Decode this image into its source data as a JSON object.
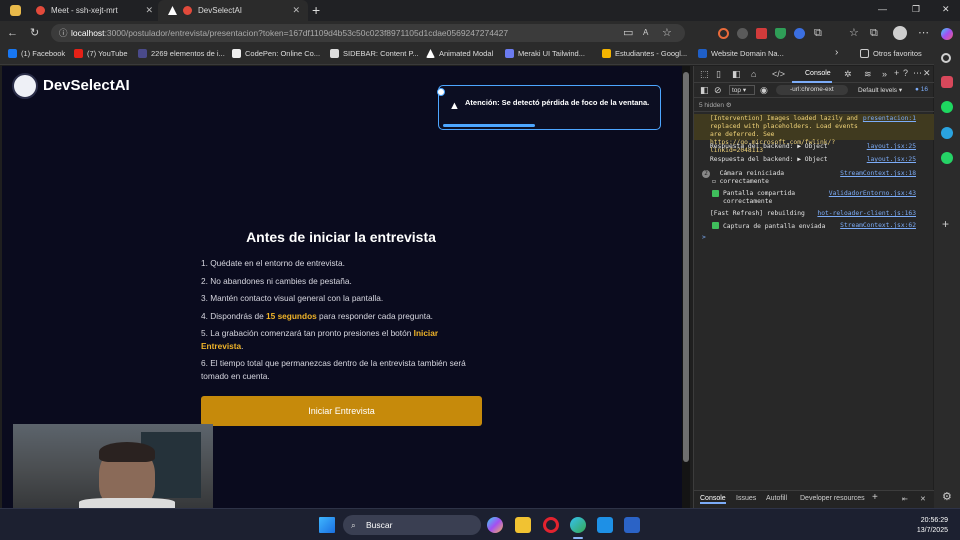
{
  "browser": {
    "tabs": [
      {
        "title": "Meet - ssh-xejt-mrt",
        "active": false
      },
      {
        "title": "DevSelectAI",
        "active": true
      }
    ],
    "new_tab": "+",
    "url_host": "localhost",
    "url_rest": ":3000/postulador/entrevista/presentacion?token=167df1109d4b53c50c023f8971105d1cdae0569247274427",
    "bookmarks": [
      "(1) Facebook",
      "(7) YouTube",
      "2269 elementos de i...",
      "CodePen: Online Co...",
      "SIDEBAR: Content P...",
      "Animated Modal",
      "Meraki UI Tailwind...",
      "Estudiantes - Googl...",
      "Website Domain Na...",
      "Otros favoritos"
    ]
  },
  "page": {
    "brand": "DevSelectAI",
    "alert": "Atención: Se detectó pérdida de foco de la ventana.",
    "title": "Antes de iniciar la entrevista",
    "instructions": {
      "i1": "1. Quédate en el entorno de entrevista.",
      "i2": "2. No abandones ni cambies de pestaña.",
      "i3": "3. Mantén contacto visual general con la pantalla.",
      "i4_pre": "4. Dispondrás de ",
      "i4_hl": "15 segundos",
      "i4_post": " para responder cada pregunta.",
      "i5_pre": "5. La grabación comenzará tan pronto presiones el botón ",
      "i5_hl": "Iniciar Entrevista",
      "i5_post": ".",
      "i6": "6. El tiempo total que permanezcas dentro de la entrevista también será tomado en cuenta."
    },
    "start_button": "Iniciar Entrevista"
  },
  "devtools": {
    "active_tab": "Console",
    "context": "top",
    "filter": "-url:chrome-ext",
    "levels": "Default levels",
    "issues_count": "16",
    "hidden": "5 hidden",
    "logs": [
      {
        "text": "[Intervention] Images loaded lazily and replaced with placeholders. Load events are deferred. See https://go.microsoft.com/fwlink/?linkid=2048113",
        "src": "presentacion:1"
      },
      {
        "text": "Respuesta del backend:  ▶ Object",
        "src": "layout.jsx:25"
      },
      {
        "text": "Respuesta del backend:  ▶ Object",
        "src": "layout.jsx:25"
      },
      {
        "text": "Cámara reiniciada correctamente",
        "src": "StreamContext.jsx:18",
        "count": "2"
      },
      {
        "text": "Pantalla compartida correctamente",
        "src": "ValidadorEntorno.jsx:43"
      },
      {
        "text": "[Fast Refresh] rebuilding",
        "src": "hot-reloader-client.js:163"
      },
      {
        "text": "Captura de pantalla enviada",
        "src": "StreamContext.jsx:62"
      }
    ],
    "prompt": ">",
    "bottom_tabs": [
      "Console",
      "Issues",
      "Autofill",
      "Developer resources"
    ]
  },
  "taskbar": {
    "search": "Buscar",
    "time": "20:56:29",
    "date": "13/7/2025"
  },
  "colors": {
    "page_bg": "#0a0b1e",
    "accent_button": "#c68a0b",
    "highlight": "#f0b429",
    "alert_border": "#4da6ff"
  }
}
